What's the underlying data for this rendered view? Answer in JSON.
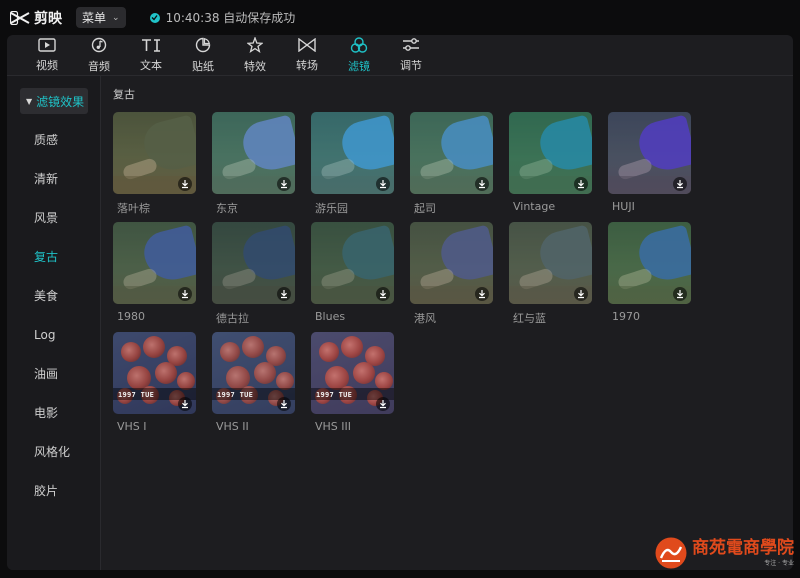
{
  "app": {
    "name": "剪映",
    "menu_label": "菜单",
    "save_status": "10:40:38 自动保存成功"
  },
  "toolbar": {
    "tabs": [
      {
        "label": "视频",
        "icon": "video-icon"
      },
      {
        "label": "音频",
        "icon": "audio-icon"
      },
      {
        "label": "文本",
        "icon": "text-icon"
      },
      {
        "label": "贴纸",
        "icon": "sticker-icon"
      },
      {
        "label": "特效",
        "icon": "effects-icon"
      },
      {
        "label": "转场",
        "icon": "transition-icon"
      },
      {
        "label": "滤镜",
        "icon": "filter-icon",
        "active": true
      },
      {
        "label": "调节",
        "icon": "adjust-icon"
      }
    ]
  },
  "sidebar": {
    "header": "滤镜效果",
    "items": [
      "质感",
      "清新",
      "风景",
      "复古",
      "美食",
      "Log",
      "油画",
      "电影",
      "风格化",
      "胶片"
    ],
    "active": "复古"
  },
  "content": {
    "section_title": "复古",
    "filters": [
      {
        "label": "落叶棕",
        "kind": "person",
        "sleeve": "#4a5a4a",
        "haze": "rgba(120,110,60,0.25)"
      },
      {
        "label": "东京",
        "kind": "person",
        "sleeve": "#6f74c9",
        "haze": "rgba(60,170,160,0.30)"
      },
      {
        "label": "游乐园",
        "kind": "person",
        "sleeve": "#4d8fd0",
        "haze": "rgba(40,160,190,0.35)"
      },
      {
        "label": "起司",
        "kind": "person",
        "sleeve": "#4e7fcf",
        "haze": "rgba(60,170,150,0.30)"
      },
      {
        "label": "Vintage",
        "kind": "person",
        "sleeve": "#2f7fc4",
        "haze": "rgba(30,150,110,0.40)"
      },
      {
        "label": "HUJI",
        "kind": "person",
        "sleeve": "#5a3fc8",
        "haze": "rgba(60,60,160,0.30)"
      },
      {
        "label": "1980",
        "kind": "person",
        "sleeve": "#3f55b8",
        "haze": "rgba(70,110,80,0.30)"
      },
      {
        "label": "德古拉",
        "kind": "person",
        "sleeve": "#3a4f86",
        "haze": "rgba(40,70,70,0.40)"
      },
      {
        "label": "Blues",
        "kind": "person",
        "sleeve": "#3e6a84",
        "haze": "rgba(50,90,70,0.40)"
      },
      {
        "label": "港风",
        "kind": "person",
        "sleeve": "#4b58a0",
        "haze": "rgba(90,100,80,0.30)"
      },
      {
        "label": "红与蓝",
        "kind": "person",
        "sleeve": "#4c6470",
        "haze": "rgba(90,100,90,0.35)"
      },
      {
        "label": "1970",
        "kind": "person",
        "sleeve": "#3a5fc2",
        "haze": "rgba(60,140,80,0.30)"
      },
      {
        "label": "VHS I",
        "kind": "flowers",
        "stamp": "1997 TUE",
        "tint": "rgba(60,70,120,0.25)"
      },
      {
        "label": "VHS II",
        "kind": "flowers",
        "stamp": "1997 TUE",
        "tint": "rgba(70,90,130,0.30)"
      },
      {
        "label": "VHS III",
        "kind": "flowers",
        "stamp": "1997 TUE",
        "tint": "rgba(110,80,120,0.30)"
      }
    ]
  },
  "watermark": {
    "text": "商苑電商學院",
    "sub": "专注 · 专业"
  },
  "colors": {
    "accent": "#1fc2c7",
    "panel": "#1d1d20",
    "background": "#0c0c0d",
    "watermark": "#e04a1c"
  }
}
